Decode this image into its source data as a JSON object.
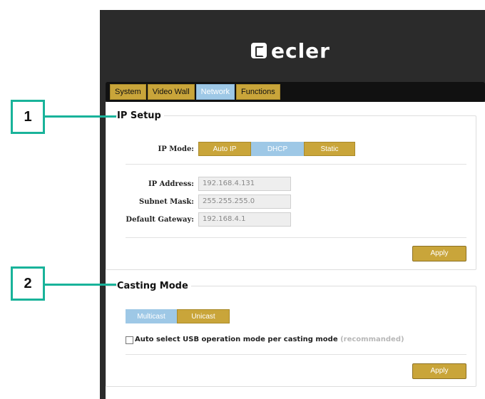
{
  "logo": {
    "text": "ecler"
  },
  "nav": {
    "tabs": [
      {
        "label": "System",
        "active": false
      },
      {
        "label": "Video Wall",
        "active": false
      },
      {
        "label": "Network",
        "active": true
      },
      {
        "label": "Functions",
        "active": false
      }
    ]
  },
  "ip_setup": {
    "title": "IP Setup",
    "mode_label": "IP Mode:",
    "modes": [
      "Auto IP",
      "DHCP",
      "Static"
    ],
    "selected_mode": "DHCP",
    "ip_label": "IP Address:",
    "ip_value": "192.168.4.131",
    "mask_label": "Subnet Mask:",
    "mask_value": "255.255.255.0",
    "gateway_label": "Default Gateway:",
    "gateway_value": "192.168.4.1",
    "apply_label": "Apply"
  },
  "casting": {
    "title": "Casting Mode",
    "modes": [
      "Multicast",
      "Unicast"
    ],
    "selected_mode": "Multicast",
    "usb_label": "Auto select USB operation mode per casting mode",
    "usb_hint": "(recommanded)",
    "usb_checked": false,
    "apply_label": "Apply"
  },
  "callouts": [
    "1",
    "2"
  ],
  "colors": {
    "accent_gold": "#c9a53a",
    "selected_blue": "#9ec8e6",
    "callout_teal": "#19b39a",
    "dark_bg": "#2b2b2b"
  }
}
